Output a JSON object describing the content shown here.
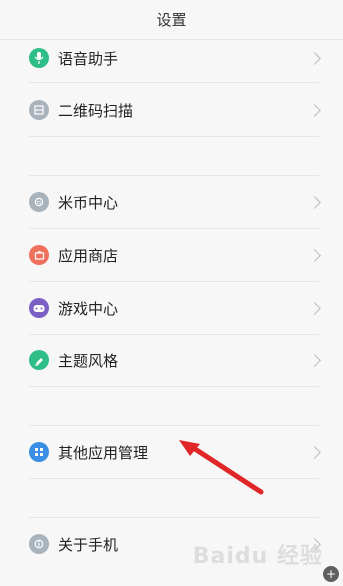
{
  "header": {
    "title": "设置"
  },
  "items": [
    {
      "label": "语音助手",
      "icon": "mic-icon",
      "color": "#2fbd87"
    },
    {
      "label": "二维码扫描",
      "icon": "scan-icon",
      "color": "#a9b3bb"
    },
    {
      "label": "米币中心",
      "icon": "coin-icon",
      "color": "#a9b3bb"
    },
    {
      "label": "应用商店",
      "icon": "store-icon",
      "color": "#f0705e"
    },
    {
      "label": "游戏中心",
      "icon": "game-icon",
      "color": "#7b5fc4"
    },
    {
      "label": "主题风格",
      "icon": "theme-icon",
      "color": "#2fbd87"
    },
    {
      "label": "其他应用管理",
      "icon": "apps-icon",
      "color": "#3a8ee6"
    },
    {
      "label": "关于手机",
      "icon": "info-icon",
      "color": "#a9b3bb"
    }
  ],
  "watermark": "Baidu 经验"
}
